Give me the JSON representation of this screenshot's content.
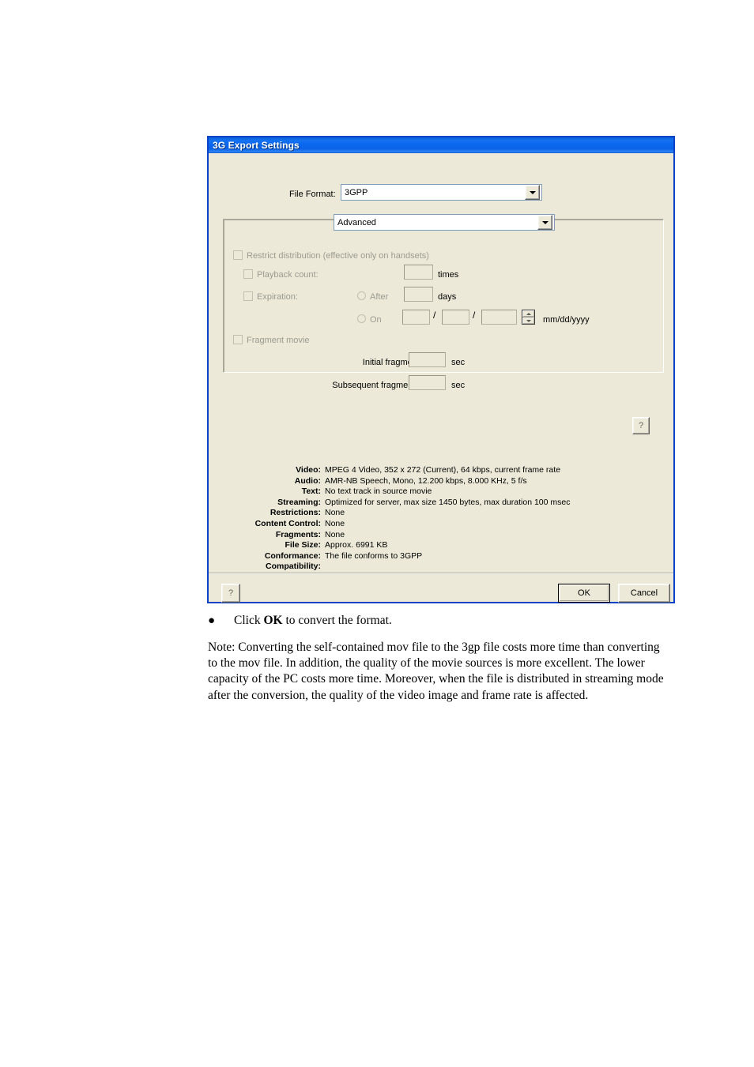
{
  "page": {
    "bullet_marker": "●",
    "bullet_text_pre": "Click ",
    "bullet_text_bold": "OK",
    "bullet_text_post": " to convert the format.",
    "note_paragraph": "Note: Converting the self-contained mov file to the 3gp file costs more time than converting to the mov file. In addition, the quality of the movie sources is more excellent. The lower capacity of the PC costs more time. Moreover, when the file is distributed in streaming mode after the conversion, the quality of the video image and frame rate is affected."
  },
  "dialog": {
    "title": "3G Export Settings",
    "file_format": {
      "label": "File Format:",
      "value": "3GPP"
    },
    "section_selector": {
      "value": "Advanced"
    },
    "options": {
      "restrict_distribution": {
        "label": "Restrict distribution (effective only on handsets)",
        "checked": false,
        "enabled": false
      },
      "playback_count": {
        "label": "Playback count:",
        "value": "",
        "unit": "times",
        "checked": false,
        "enabled": false
      },
      "expiration": {
        "label": "Expiration:",
        "checked": false,
        "enabled": false,
        "after": {
          "label": "After",
          "value": "",
          "unit": "days",
          "selected": false
        },
        "on": {
          "label": "On",
          "month": "",
          "day": "",
          "year": "",
          "separator": "/",
          "format_hint": "mm/dd/yyyy",
          "selected": false
        }
      },
      "fragment_movie": {
        "label": "Fragment movie",
        "checked": false,
        "enabled": false
      },
      "initial_fragment": {
        "label": "Initial fragment:",
        "value": "",
        "unit": "sec"
      },
      "subsequent_fragments": {
        "label": "Subsequent fragments:",
        "value": "",
        "unit": "sec"
      }
    },
    "group_help_button": "?",
    "info": [
      {
        "key": "Video:",
        "value": "MPEG 4 Video, 352 x 272 (Current), 64 kbps, current frame rate"
      },
      {
        "key": "Audio:",
        "value": "AMR-NB Speech, Mono, 12.200 kbps, 8.000 KHz, 5 f/s"
      },
      {
        "key": "Text:",
        "value": "No text track in source movie"
      },
      {
        "key": "Streaming:",
        "value": "Optimized for server, max size 1450 bytes, max duration 100 msec"
      },
      {
        "key": "Restrictions:",
        "value": "None"
      },
      {
        "key": "Content Control:",
        "value": "None"
      },
      {
        "key": "Fragments:",
        "value": "None"
      },
      {
        "key": "File Size:",
        "value": "Approx. 6991 KB"
      },
      {
        "key": "Conformance:",
        "value": "The file conforms to 3GPP"
      },
      {
        "key": "Compatibility:",
        "value": ""
      }
    ],
    "buttons": {
      "help": "?",
      "ok": "OK",
      "cancel": "Cancel"
    }
  },
  "colors": {
    "titlebar_blue": "#0a68f0",
    "dialog_face": "#ece9d8",
    "dialog_border": "#0a42c8",
    "disabled_text": "#9b9a8e"
  }
}
